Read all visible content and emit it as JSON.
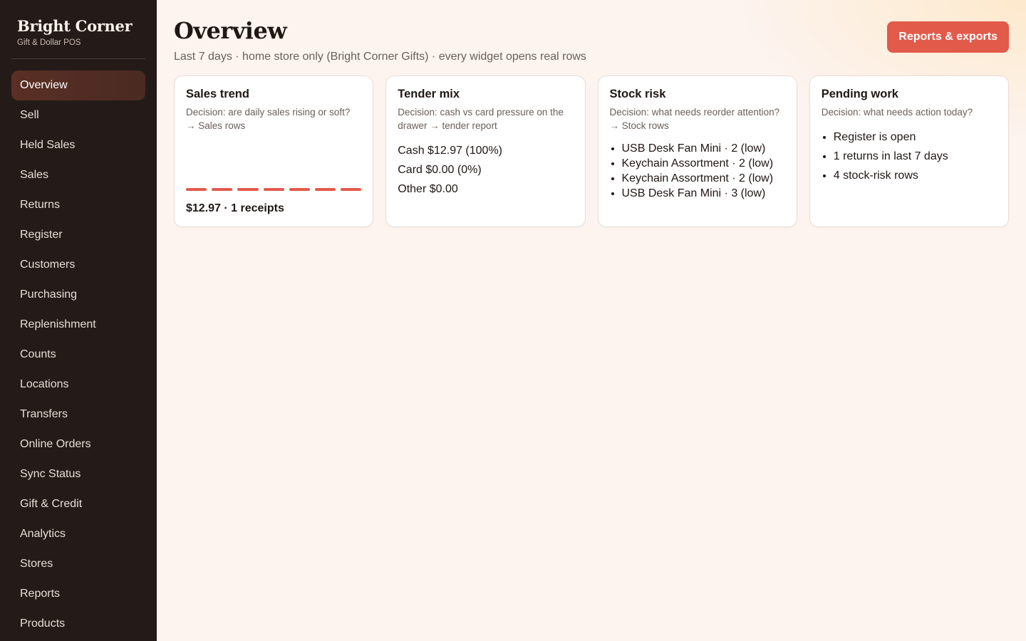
{
  "brand": {
    "name": "Bright Corner",
    "subtitle": "Gift & Dollar POS"
  },
  "nav": [
    {
      "label": "Overview",
      "active": true
    },
    {
      "label": "Sell"
    },
    {
      "label": "Held Sales"
    },
    {
      "label": "Sales"
    },
    {
      "label": "Returns"
    },
    {
      "label": "Register"
    },
    {
      "label": "Customers"
    },
    {
      "label": "Purchasing"
    },
    {
      "label": "Replenishment"
    },
    {
      "label": "Counts"
    },
    {
      "label": "Locations"
    },
    {
      "label": "Transfers"
    },
    {
      "label": "Online Orders"
    },
    {
      "label": "Sync Status"
    },
    {
      "label": "Gift & Credit"
    },
    {
      "label": "Analytics"
    },
    {
      "label": "Stores"
    },
    {
      "label": "Reports"
    },
    {
      "label": "Products"
    }
  ],
  "header": {
    "title": "Overview",
    "subtitle": "Last 7 days · home store only (Bright Corner Gifts) · every widget opens real rows",
    "reports_button": "Reports & exports"
  },
  "cards": {
    "sales_trend": {
      "title": "Sales trend",
      "description": "Decision: are daily sales rising or soft? → Sales rows",
      "day_count": 7,
      "summary": "$12.97 · 1 receipts"
    },
    "tender_mix": {
      "title": "Tender mix",
      "description": "Decision: cash vs card pressure on the drawer → tender report",
      "lines": [
        "Cash $12.97 (100%)",
        "Card $0.00 (0%)",
        "Other $0.00"
      ]
    },
    "stock_risk": {
      "title": "Stock risk",
      "description": "Decision: what needs reorder attention? → Stock rows",
      "items": [
        "USB Desk Fan Mini · 2 (low)",
        "Keychain Assortment · 2 (low)",
        "Keychain Assortment · 2 (low)",
        "USB Desk Fan Mini · 3 (low)"
      ]
    },
    "pending_work": {
      "title": "Pending work",
      "description": "Decision: what needs action today?",
      "items": [
        "Register is open",
        "1 returns in last 7 days",
        "4 stock-risk rows"
      ]
    }
  },
  "colors": {
    "accent": "#e25a4a",
    "sidebar_bg": "#241b18",
    "active_nav_bg": "#5a2f25",
    "page_bg": "#fdf4f0"
  }
}
